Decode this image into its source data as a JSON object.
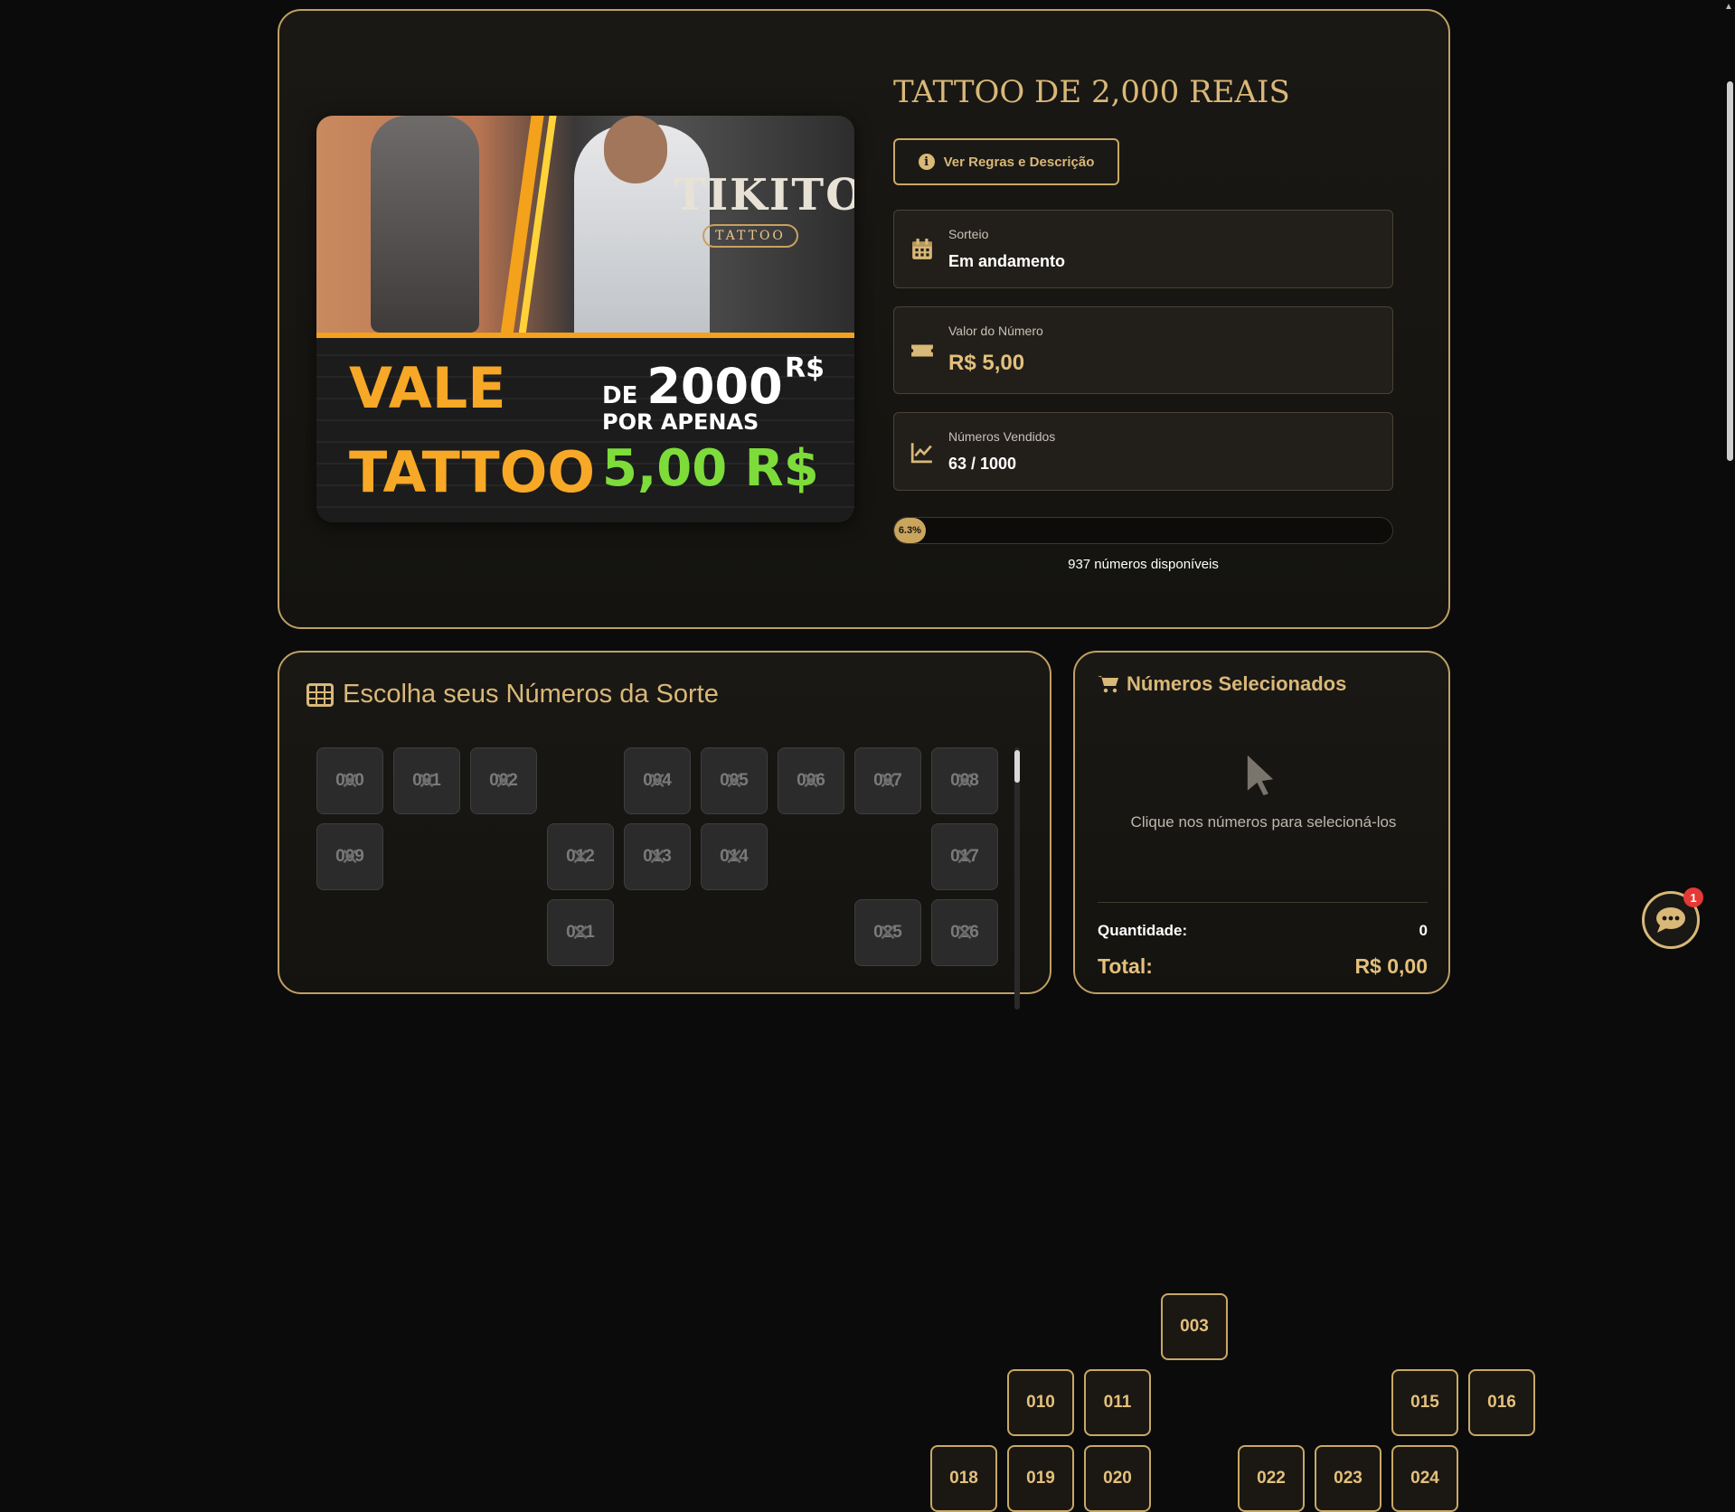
{
  "raffle": {
    "title": "TATTOO DE 2,000 REAIS",
    "rules_button": "Ver Regras e Descrição",
    "status_label": "Sorteio",
    "status_value": "Em andamento",
    "price_label": "Valor do Número",
    "price_value": "R$ 5,00",
    "sold_label": "Números Vendidos",
    "sold_value": "63 / 1000",
    "progress_percent": 6.3,
    "progress_text": "6.3%",
    "available_text": "937 números disponíveis"
  },
  "banner": {
    "logo_text": "TIKITO",
    "logo_sub": "TATTOO",
    "vale": "VALE",
    "tattoo": "TATTOO",
    "de": "DE",
    "de_amount": "2000",
    "currency_top": "R$",
    "por_apenas": "POR APENAS",
    "price": "5,00 R$"
  },
  "picker": {
    "title": "Escolha seus Números da Sorte",
    "numbers": [
      {
        "n": "000",
        "sold": true
      },
      {
        "n": "001",
        "sold": true
      },
      {
        "n": "002",
        "sold": true
      },
      {
        "n": "003",
        "sold": false
      },
      {
        "n": "004",
        "sold": true
      },
      {
        "n": "005",
        "sold": true
      },
      {
        "n": "006",
        "sold": true
      },
      {
        "n": "007",
        "sold": true
      },
      {
        "n": "008",
        "sold": true
      },
      {
        "n": "009",
        "sold": true
      },
      {
        "n": "010",
        "sold": false
      },
      {
        "n": "011",
        "sold": false
      },
      {
        "n": "012",
        "sold": true
      },
      {
        "n": "013",
        "sold": true
      },
      {
        "n": "014",
        "sold": true
      },
      {
        "n": "015",
        "sold": false
      },
      {
        "n": "016",
        "sold": false
      },
      {
        "n": "017",
        "sold": true
      },
      {
        "n": "018",
        "sold": false
      },
      {
        "n": "019",
        "sold": false
      },
      {
        "n": "020",
        "sold": false
      },
      {
        "n": "021",
        "sold": true
      },
      {
        "n": "022",
        "sold": false
      },
      {
        "n": "023",
        "sold": false
      },
      {
        "n": "024",
        "sold": false
      },
      {
        "n": "025",
        "sold": true
      },
      {
        "n": "026",
        "sold": true
      }
    ]
  },
  "selected": {
    "title": "Números Selecionados",
    "hint": "Clique nos números para selecioná-los",
    "qty_label": "Quantidade:",
    "qty_value": "0",
    "total_label": "Total:",
    "total_value": "R$ 0,00"
  },
  "chat": {
    "badge": "1"
  },
  "colors": {
    "accent": "#d9b878",
    "border": "#bfa062",
    "price_green": "#7ddc3a",
    "orange": "#f7a826"
  }
}
